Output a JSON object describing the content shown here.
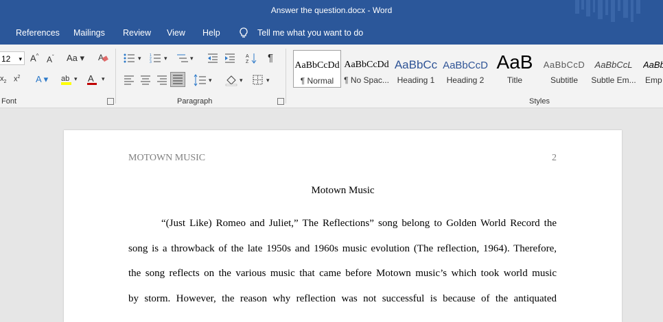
{
  "titlebar": {
    "title": "Answer the question.docx  -  Word"
  },
  "tabs": [
    {
      "label": "References"
    },
    {
      "label": "Mailings"
    },
    {
      "label": "Review"
    },
    {
      "label": "View"
    },
    {
      "label": "Help"
    }
  ],
  "tell_me": "Tell me what you want to do",
  "font_group": {
    "size": "12",
    "label": "Font"
  },
  "paragraph_group": {
    "label": "Paragraph"
  },
  "styles_group": {
    "label": "Styles",
    "styles": [
      {
        "sample": "AaBbCcDd",
        "name": "¶ Normal"
      },
      {
        "sample": "AaBbCcDd",
        "name": "¶ No Spac..."
      },
      {
        "sample": "AaBbCc",
        "name": "Heading 1"
      },
      {
        "sample": "AaBbCcD",
        "name": "Heading 2"
      },
      {
        "sample": "AaB",
        "name": "Title"
      },
      {
        "sample": "AaBbCcD",
        "name": "Subtitle"
      },
      {
        "sample": "AaBbCcL",
        "name": "Subtle Em..."
      },
      {
        "sample": "AaBbCcL",
        "name": "Emp"
      }
    ]
  },
  "document": {
    "header_left": "MOTOWN MUSIC",
    "header_right": "2",
    "title": "Motown Music",
    "lines": [
      "“(Just Like) Romeo and Juliet,” The Reflections” song belong to Golden World Record the",
      "song is a throwback of the late 1950s and 1960s music evolution (The reflection, 1964). Therefore,",
      "the song reflects on the various music that came before Motown music’s which took world music",
      "by storm. However, the reason why reflection was not successful is because of the antiquated"
    ]
  },
  "colors": {
    "accent": "#2b579a",
    "ribbon": "#f3f3f3",
    "canvas": "#e6e6e6"
  }
}
